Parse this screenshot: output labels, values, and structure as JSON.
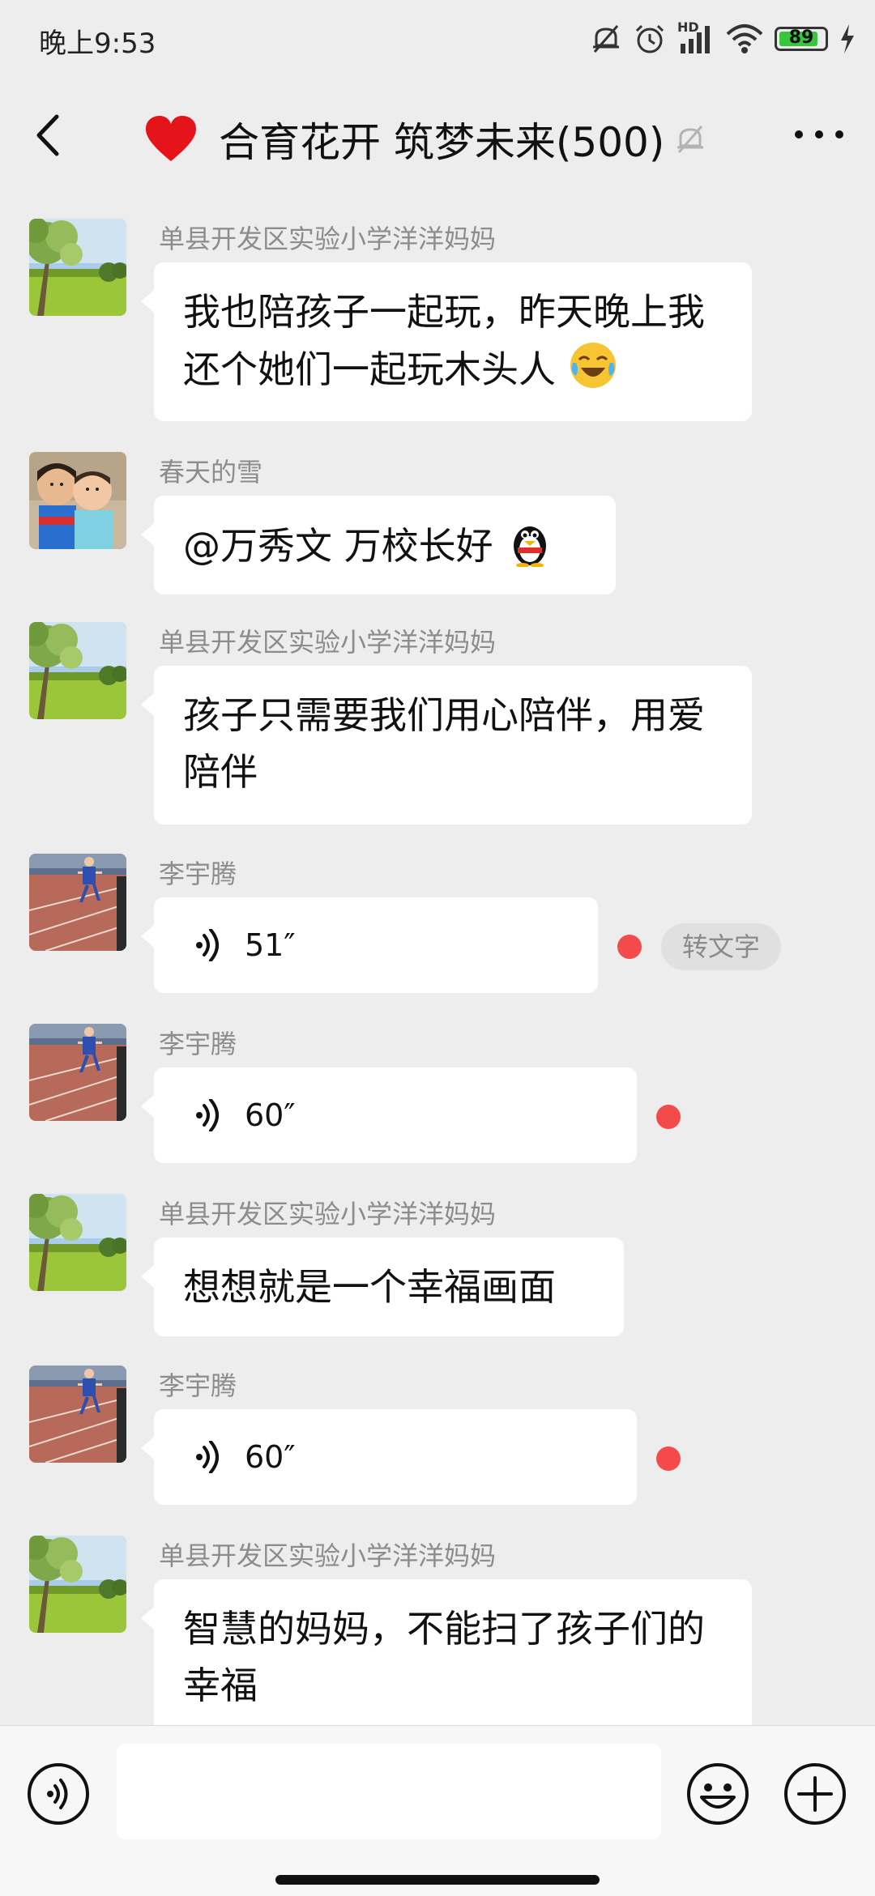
{
  "status_bar": {
    "time": "晚上9:53",
    "battery": "89",
    "network_label": "HD"
  },
  "header": {
    "title": "合育花开 筑梦未来(500)"
  },
  "messages": [
    {
      "sender": "单县开发区实验小学洋洋妈妈",
      "text": "我也陪孩子一起玩，昨天晚上我还个她们一起玩木头人",
      "emoji": "face-with-tears-of-joy-icon"
    },
    {
      "sender": "春天的雪",
      "text": "@万秀文  万校长好",
      "emoji": "penguin-icon"
    },
    {
      "sender": "单县开发区实验小学洋洋妈妈",
      "text": "孩子只需要我们用心陪伴，用爱陪伴"
    },
    {
      "sender": "李宇腾",
      "voice_duration": "51″",
      "convert_label": "转文字"
    },
    {
      "sender": "李宇腾",
      "voice_duration": "60″"
    },
    {
      "sender": "单县开发区实验小学洋洋妈妈",
      "text": "想想就是一个幸福画面"
    },
    {
      "sender": "李宇腾",
      "voice_duration": "60″"
    },
    {
      "sender": "单县开发区实验小学洋洋妈妈",
      "text": "智慧的妈妈，不能扫了孩子们的幸福"
    }
  ],
  "input_bar": {
    "placeholder": ""
  },
  "colors": {
    "background": "#ededed",
    "bubble": "#ffffff",
    "unread_dot": "#f34b4b",
    "battery_fill": "#39c53d"
  }
}
